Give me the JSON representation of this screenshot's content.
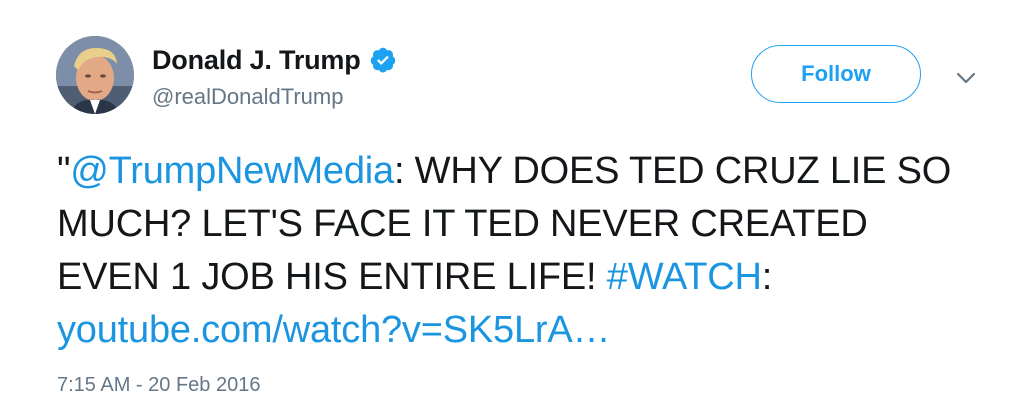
{
  "author": {
    "display_name": "Donald J. Trump",
    "handle": "@realDonaldTrump",
    "verified_icon": "verified-badge-icon"
  },
  "actions": {
    "follow_label": "Follow",
    "menu_icon": "chevron-down-icon"
  },
  "tweet": {
    "quote_open": "\"",
    "mention": "@TrumpNewMedia",
    "text_1": ": WHY DOES TED CRUZ LIE SO MUCH? LET'S FACE IT TED NEVER CREATED EVEN 1 JOB HIS ENTIRE LIFE! ",
    "hashtag": "#WATCH",
    "text_2": ": ",
    "link": "youtube.com/watch?v=SK5LrA…"
  },
  "meta": {
    "timestamp": "7:15 AM - 20 Feb 2016"
  },
  "colors": {
    "link": "#1b95e0",
    "follow_accent": "#1da1f2",
    "text": "#14171a",
    "muted": "#657786"
  }
}
